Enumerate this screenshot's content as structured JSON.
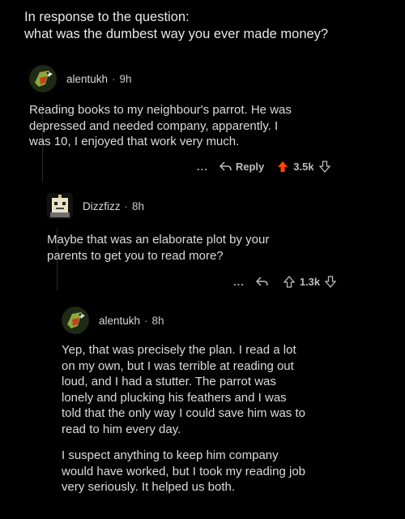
{
  "header": {
    "line1": "In response to the question:",
    "line2": "what was the dumbest way you ever made money?"
  },
  "comments": [
    {
      "user": "alentukh",
      "time": "9h",
      "body": [
        "Reading books to my neighbour's parrot. He was",
        "depressed and needed company, apparently. I",
        "was 10, I enjoyed that work very much."
      ],
      "actions": {
        "more": "...",
        "reply_label": "Reply",
        "score": "3.5k",
        "upvoted": true
      }
    },
    {
      "user": "Dizzfizz",
      "time": "8h",
      "body": [
        "Maybe that was an elaborate plot by your",
        "parents to get you to read more?"
      ],
      "actions": {
        "more": "...",
        "score": "1.3k",
        "upvoted": false
      }
    },
    {
      "user": "alentukh",
      "time": "8h",
      "paragraphs": [
        [
          "Yep, that was precisely the plan. I read a lot",
          "on my own, but I was terrible at reading out",
          "loud, and I had a stutter. The parrot was",
          "lonely and plucking his feathers and I was",
          "told that the only way I could save him was to",
          "read to him every day."
        ],
        [
          "I suspect anything to keep him company",
          "would have worked, but I took my reading job",
          "very seriously. It helped us both."
        ]
      ]
    }
  ],
  "separator": "·",
  "colors": {
    "background": "#000000",
    "upvote_active": "#ff4500",
    "text": "#dcdcdc"
  },
  "icons": {
    "reply": "reply-arrow-icon",
    "upvote": "upvote-arrow-icon",
    "downvote": "downvote-arrow-icon"
  }
}
